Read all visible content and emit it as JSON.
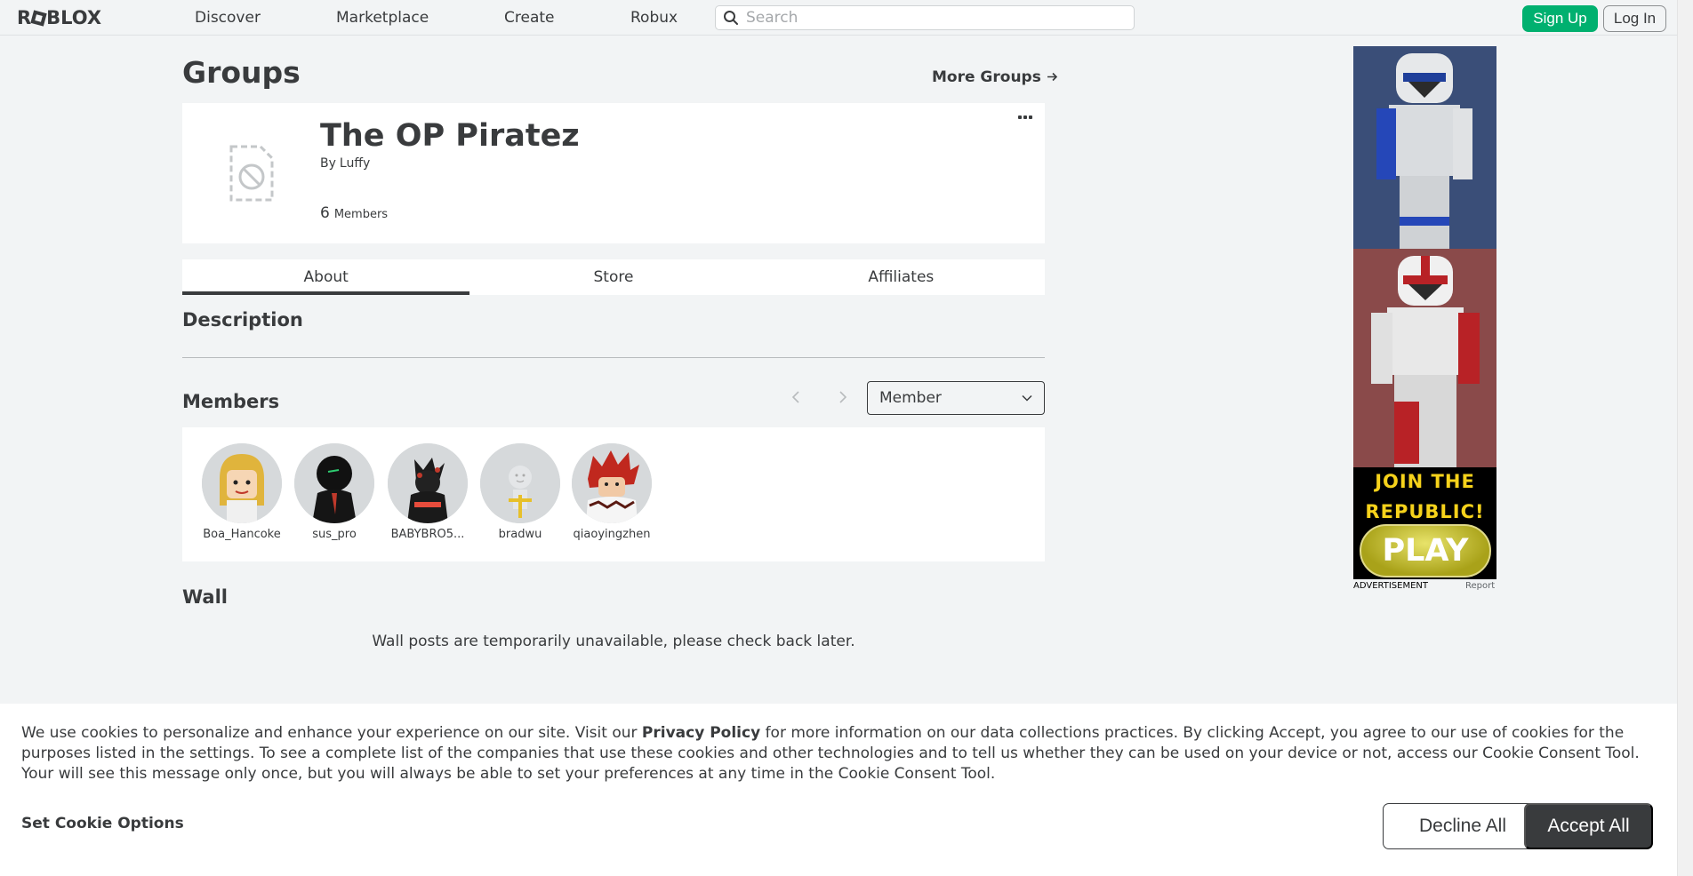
{
  "nav": {
    "logo": "ROBLOX",
    "links": [
      "Discover",
      "Marketplace",
      "Create",
      "Robux"
    ],
    "search_placeholder": "Search",
    "signup_label": "Sign Up",
    "login_label": "Log In"
  },
  "page": {
    "title": "Groups",
    "more_groups": "More Groups"
  },
  "group": {
    "name": "The OP Piratez",
    "by_label": "By",
    "owner": "Luffy",
    "member_count": "6",
    "member_label": "Members"
  },
  "tabs": [
    {
      "label": "About",
      "active": true
    },
    {
      "label": "Store",
      "active": false
    },
    {
      "label": "Affiliates",
      "active": false
    }
  ],
  "description": {
    "heading": "Description"
  },
  "members": {
    "heading": "Members",
    "role_selected": "Member",
    "list": [
      {
        "name": "Boa_Hancoke"
      },
      {
        "name": "sus_pro"
      },
      {
        "name": "BABYBRO5..."
      },
      {
        "name": "bradwu"
      },
      {
        "name": "qiaoyingzhen"
      }
    ]
  },
  "wall": {
    "heading": "Wall",
    "message": "Wall posts are temporarily unavailable, please check back later."
  },
  "ad": {
    "line1": "JOIN THE",
    "line2": "REPUBLIC!",
    "play": "PLAY",
    "label": "ADVERTISEMENT",
    "report": "Report"
  },
  "cookie": {
    "text_before": "We use cookies to personalize and enhance your experience on our site. Visit our ",
    "privacy_link": "Privacy Policy",
    "text_after": " for more information on our data collections practices. By clicking Accept, you agree to our use of cookies for the purposes listed in the settings. To see a complete list of the companies that use these cookies and other technologies and to tell us whether they can be used on your device or not, access our Cookie Consent Tool. Your will see this message only once, but you will always be able to set your preferences at any time in the Cookie Consent Tool.",
    "set_options": "Set Cookie Options",
    "decline": "Decline All",
    "accept": "Accept All"
  },
  "colors": {
    "accent_green": "#00b06f",
    "text_dark": "#393b3d",
    "page_bg": "#f2f4f5"
  }
}
